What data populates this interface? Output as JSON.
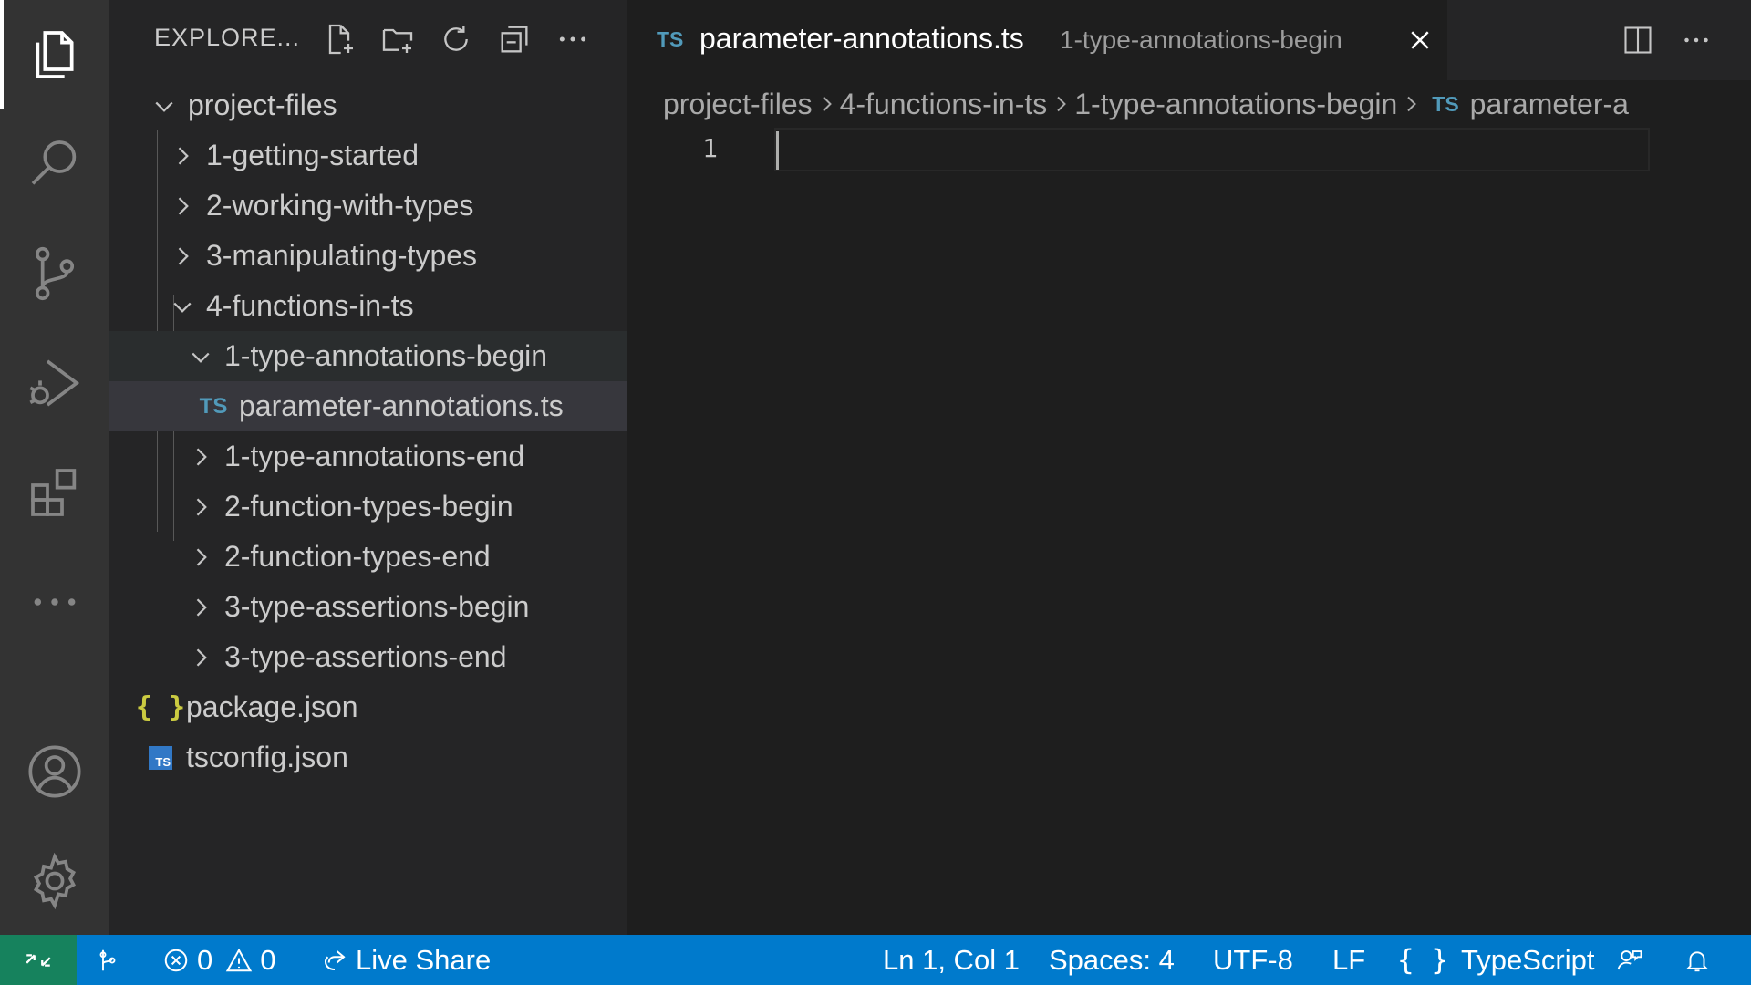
{
  "sidebar": {
    "title": "EXPLORE...",
    "actions": [
      "new-file-icon",
      "new-folder-icon",
      "refresh-icon",
      "collapse-all-icon",
      "more-icon"
    ]
  },
  "tree": {
    "root": "project-files",
    "folders_top": [
      "1-getting-started",
      "2-working-with-types",
      "3-manipulating-types"
    ],
    "open_folder": "4-functions-in-ts",
    "open_subfolder": "1-type-annotations-begin",
    "open_file": "parameter-annotations.ts",
    "subfolders": [
      "1-type-annotations-end",
      "2-function-types-begin",
      "2-function-types-end",
      "3-type-assertions-begin",
      "3-type-assertions-end"
    ],
    "root_files": [
      "package.json",
      "tsconfig.json"
    ],
    "ts_badge": "TS",
    "json_badge": "{ }"
  },
  "tab": {
    "lang_badge": "TS",
    "name": "parameter-annotations.ts",
    "description": "1-type-annotations-begin"
  },
  "breadcrumbs": {
    "parts": [
      "project-files",
      "4-functions-in-ts",
      "1-type-annotations-begin"
    ],
    "file_badge": "TS",
    "file": "parameter-a"
  },
  "editor": {
    "line_number": "1"
  },
  "statusbar": {
    "errors": "0",
    "warnings": "0",
    "live_share": "Live Share",
    "position": "Ln 1, Col 1",
    "spaces": "Spaces: 4",
    "encoding": "UTF-8",
    "eol": "LF",
    "language_braces": "{ }",
    "language": "TypeScript"
  },
  "colors": {
    "statusbar": "#007acc",
    "remote": "#16825d",
    "ts": "#519aba",
    "json": "#cbcb41"
  }
}
